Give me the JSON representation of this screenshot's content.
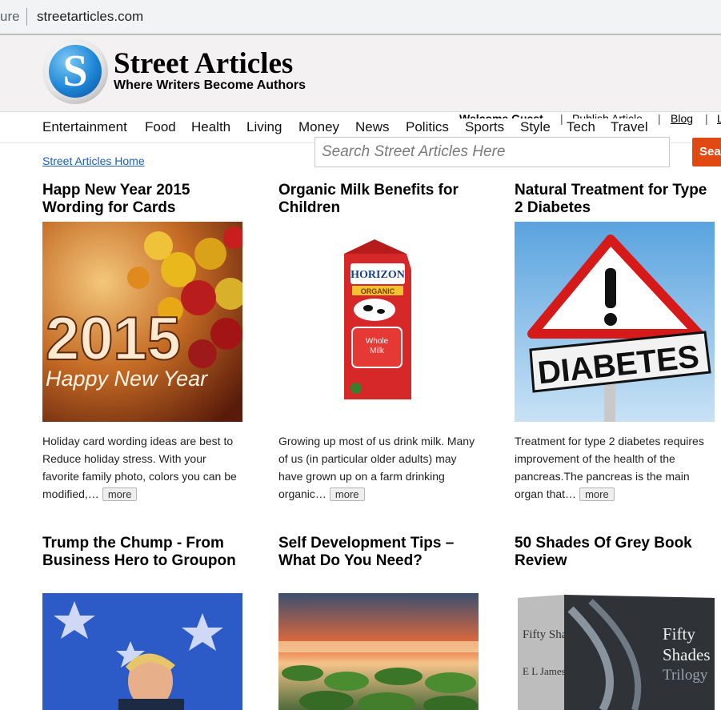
{
  "browser": {
    "secure_fragment": "ure",
    "url": "streetarticles.com"
  },
  "site": {
    "logo_letter": "S",
    "title": "Street Articles",
    "tagline": "Where Writers Become Authors"
  },
  "nav": {
    "categories": [
      "Entertainment",
      "Food",
      "Health",
      "Living",
      "Money",
      "News",
      "Politics",
      "Sports",
      "Style",
      "Tech",
      "Travel"
    ],
    "welcome": "Welcome Guest",
    "publish": "Publish Article",
    "blog": "Blog",
    "login_fragment": "L"
  },
  "search": {
    "placeholder": "Search Street Articles Here",
    "button": "Sea"
  },
  "breadcrumb": {
    "home": "Street Articles Home"
  },
  "articles": [
    {
      "title": "Happ New Year 2015 Wording for Cards",
      "image_text": "2015",
      "image_subtext": "Happy New Year",
      "excerpt": "Holiday card wording ideas are best to Reduce holiday stress. With your favorite family photo, colors you can be modified,…",
      "more": "more"
    },
    {
      "title": "Organic Milk Benefits for Children",
      "image_text": "HORIZON",
      "image_subtext": "ORGANIC",
      "image_label": "Whole Milk",
      "excerpt": "Growing up most of us drink milk. Many of us (in particular older adults) may have grown up on a farm drinking organic…",
      "more": "more"
    },
    {
      "title": "Natural Treatment for Type 2 Diabetes",
      "image_text": "DIABETES",
      "excerpt": "Treatment for type 2 diabetes requires improvement of the health of the pancreas.The pancreas is the main organ that…",
      "more": "more"
    },
    {
      "title": "Trump the Chump - From Business Hero to Groupon"
    },
    {
      "title": "Self Development Tips – What Do You Need?"
    },
    {
      "title": "50 Shades Of Grey Book Review",
      "image_text": "Fifty Shades Trilogy",
      "image_author": "E L James"
    }
  ],
  "colors": {
    "search_button": "#e04a12",
    "link": "#1a5fb4",
    "logo_blue": "#1f86d6"
  }
}
